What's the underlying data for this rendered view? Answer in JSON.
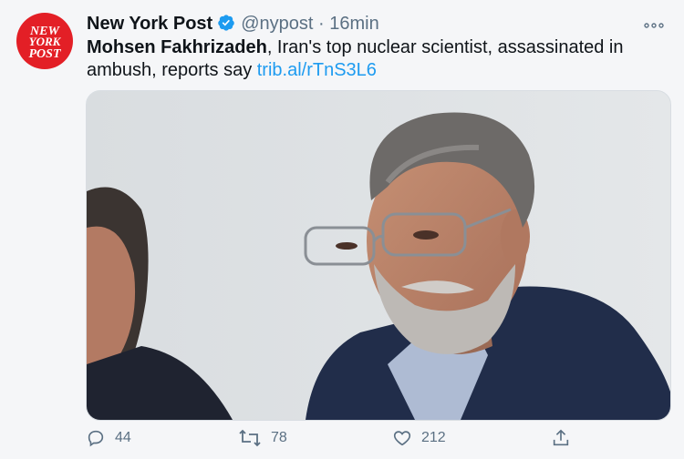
{
  "account": {
    "logo_text": [
      "NEW",
      "YORK",
      "POST"
    ],
    "name": "New York Post",
    "handle": "@nypost",
    "separator": "·",
    "time": "16min"
  },
  "tweet": {
    "bold_name": "Mohsen Fakhrizadeh",
    "text": ", Iran's top nuclear scientist, assassinated in ambush, reports say ",
    "link": "trib.al/rTnS3L6"
  },
  "actions": {
    "reply_count": "44",
    "retweet_count": "78",
    "like_count": "212"
  },
  "colors": {
    "accent": "#1d9bf0",
    "logo_red": "#e31f26",
    "muted": "#5b7083"
  }
}
